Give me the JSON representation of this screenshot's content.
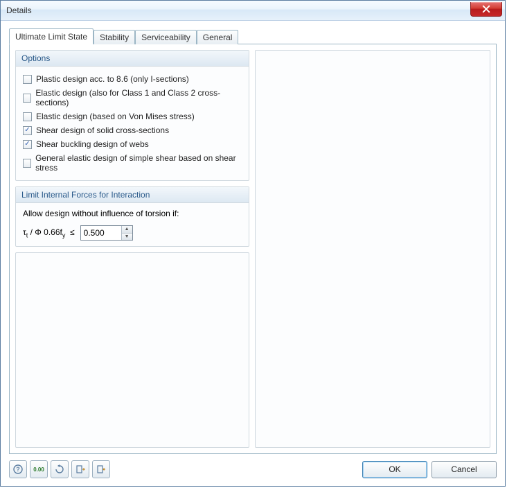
{
  "window": {
    "title": "Details"
  },
  "tabs": {
    "t0": "Ultimate Limit State",
    "t1": "Stability",
    "t2": "Serviceability",
    "t3": "General"
  },
  "options": {
    "header": "Options",
    "items": [
      {
        "label": "Plastic design acc. to 8.6 (only I-sections)",
        "checked": false
      },
      {
        "label": "Elastic design (also for Class 1 and Class 2 cross-sections)",
        "checked": false
      },
      {
        "label": "Elastic design (based on Von Mises stress)",
        "checked": false
      },
      {
        "label": "Shear design of solid cross-sections",
        "checked": true
      },
      {
        "label": "Shear buckling design of webs",
        "checked": true
      },
      {
        "label": "General elastic design of simple shear based on shear stress",
        "checked": false
      }
    ]
  },
  "limit": {
    "header": "Limit Internal Forces for Interaction",
    "caption": "Allow design without influence of torsion if:",
    "formula": "τt / Φ 0.66fy  ≤",
    "value": "0.500"
  },
  "footer": {
    "ok": "OK",
    "cancel": "Cancel"
  }
}
